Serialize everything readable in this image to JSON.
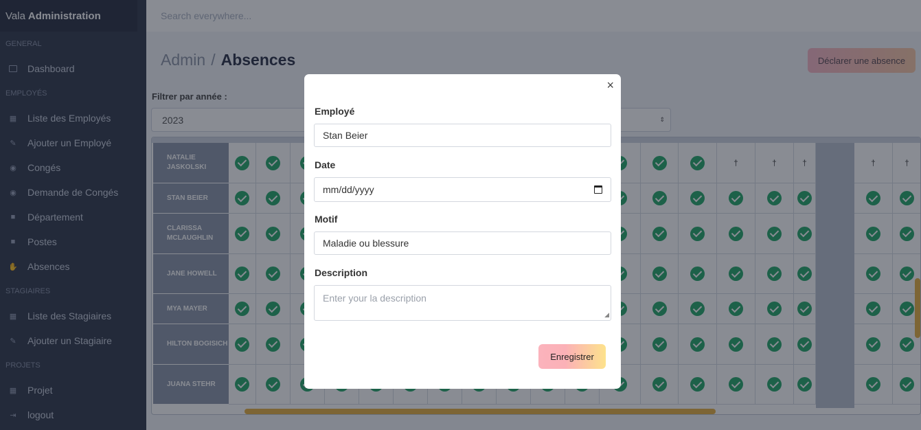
{
  "brand": {
    "prefix": "Vala",
    "name": "Administration"
  },
  "search": {
    "placeholder": "Search everywhere..."
  },
  "sidebar": {
    "sections": [
      "GENERAL",
      "EMPLOYÉS",
      "STAGIAIRES",
      "PROJETS"
    ],
    "items": [
      {
        "label": "Dashboard",
        "icon": "monitor-icon"
      },
      {
        "label": "Liste des Employés",
        "icon": "table-icon"
      },
      {
        "label": "Ajouter un Employé",
        "icon": "edit-icon"
      },
      {
        "label": "Congés",
        "icon": "eye-icon"
      },
      {
        "label": "Demande de Congés",
        "icon": "eye-icon"
      },
      {
        "label": "Département",
        "icon": "briefcase-icon"
      },
      {
        "label": "Postes",
        "icon": "briefcase-icon"
      },
      {
        "label": "Absences",
        "icon": "handshake-icon"
      },
      {
        "label": "Liste des Stagiaires",
        "icon": "table-icon"
      },
      {
        "label": "Ajouter un Stagiaire",
        "icon": "edit-icon"
      },
      {
        "label": "Projet",
        "icon": "table-icon"
      },
      {
        "label": "logout",
        "icon": "logout-icon"
      }
    ]
  },
  "breadcrumb": {
    "root": "Admin",
    "separator": "/",
    "current": "Absences"
  },
  "header": {
    "declare_button": "Déclarer une absence"
  },
  "filter": {
    "label": "Filtrer par année :",
    "year": "2023"
  },
  "employees": [
    "NATALIE JASKOLSKI",
    "STAN BEIER",
    "CLARISSA MCLAUGHLIN",
    "JANE HOWELL",
    "MYA MAYER",
    "HILTON BOGISICH",
    "JUANA STEHR"
  ],
  "modal": {
    "employee_label": "Employé",
    "employee_value": "Stan Beier",
    "date_label": "Date",
    "date_placeholder": "mm/dd/yyyy",
    "motif_label": "Motif",
    "motif_value": "Maladie ou blessure",
    "description_label": "Description",
    "description_placeholder": "Enter your la description",
    "save_button": "Enregistrer",
    "close_symbol": "×"
  },
  "colors": {
    "check": "#27a86a",
    "accent_scroll": "#e7b143",
    "sidebar_bg": "#323a4d"
  }
}
